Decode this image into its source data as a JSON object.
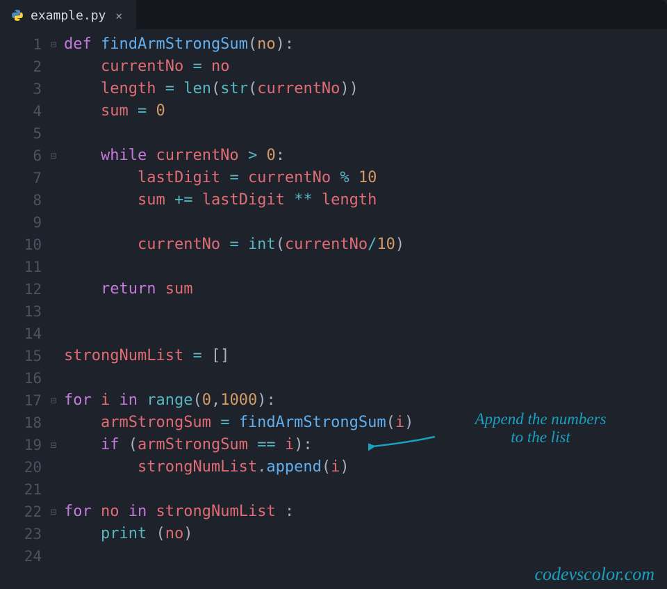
{
  "tab": {
    "filename": "example.py",
    "icon": "python-file-icon",
    "close_glyph": "✕"
  },
  "gutter": {
    "line_count": 24,
    "fold_markers": {
      "1": "⊟",
      "6": "⊟",
      "17": "⊟",
      "19": "⊟",
      "22": "⊟"
    }
  },
  "code_lines": {
    "l1": "def findArmStrongSum(no):",
    "l2": "    currentNo = no",
    "l3": "    length = len(str(currentNo))",
    "l4": "    sum = 0",
    "l5": "",
    "l6": "    while currentNo > 0:",
    "l7": "        lastDigit = currentNo % 10",
    "l8": "        sum += lastDigit ** length",
    "l9": "",
    "l10": "        currentNo = int(currentNo/10)",
    "l11": "",
    "l12": "    return sum",
    "l13": "",
    "l14": "",
    "l15": "strongNumList = []",
    "l16": "",
    "l17": "for i in range(0,1000):",
    "l18": "    armStrongSum = findArmStrongSum(i)",
    "l19": "    if (armStrongSum == i):",
    "l20": "        strongNumList.append(i)",
    "l21": "",
    "l22": "for no in strongNumList :",
    "l23": "    print (no)",
    "l24": ""
  },
  "annotation": {
    "text_line1": "Append the numbers",
    "text_line2": "to the list"
  },
  "watermark": "codevscolor.com",
  "colors": {
    "background": "#1e222a",
    "tabbar": "#14171c",
    "keyword": "#c678dd",
    "function": "#61afef",
    "builtin": "#56b6c2",
    "variable": "#e06c75",
    "number": "#d19a66",
    "punctuation": "#abb2bf",
    "gutter": "#4b5363",
    "annotation": "#1aa0c0"
  }
}
